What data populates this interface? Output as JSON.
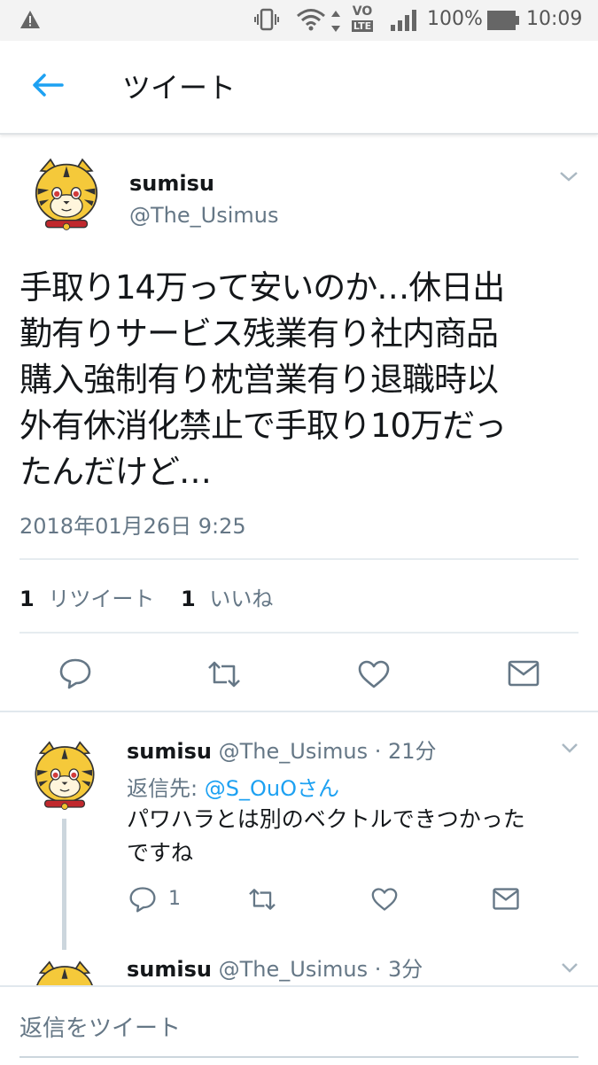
{
  "status_bar": {
    "battery": "100%",
    "time": "10:09",
    "network": "VO LTE"
  },
  "header": {
    "title": "ツイート"
  },
  "tweet": {
    "name": "sumisu",
    "handle": "@The_Usimus",
    "text_lines": [
      "手取り14万って安いのか…休日出",
      "勤有りサービス残業有り社内商品",
      "購入強制有り枕営業有り退職時以",
      "外有休消化禁止で手取り10万だっ",
      "たんだけど…"
    ],
    "timestamp": "2018年01月26日 9:25",
    "retweet_count": "1",
    "retweet_label": "リツイート",
    "like_count": "1",
    "like_label": "いいね"
  },
  "replies": [
    {
      "name": "sumisu",
      "handle": "@The_Usimus",
      "time": "· 21分",
      "reply_to_label": "返信先:",
      "reply_to_user": "@S_OuOさん",
      "text_lines": [
        "パワハラとは別のベクトルできつかった",
        "ですね"
      ],
      "reply_count": "1"
    },
    {
      "name": "sumisu",
      "handle": "@The_Usimus",
      "time": "· 3分"
    }
  ],
  "composer": {
    "placeholder": "返信をツイート"
  },
  "colors": {
    "accent": "#1da1f2",
    "muted": "#657786",
    "text": "#14171a",
    "divider": "#e6ecf0"
  },
  "icons": [
    "warning-icon",
    "vibrate-icon",
    "wifi-icon",
    "signal-icon",
    "battery-icon",
    "back-arrow-icon",
    "chevron-down-icon",
    "reply-icon",
    "retweet-icon",
    "like-icon",
    "share-mail-icon"
  ]
}
